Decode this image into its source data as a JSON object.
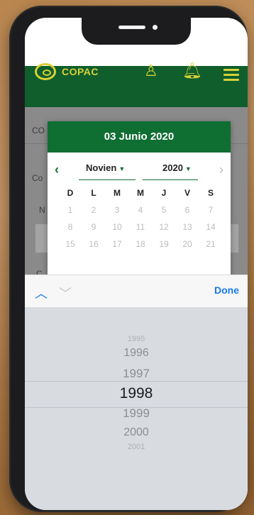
{
  "app": {
    "brand": "COPAC",
    "colors": {
      "primary": "#0f5e2c",
      "accent": "#d8d036",
      "ios_blue": "#1a7ae8"
    }
  },
  "page": {
    "label_1": "CO",
    "label_2": "Co",
    "label_3": "N",
    "label_4": "C"
  },
  "datepicker": {
    "header": "03 Junio 2020",
    "month_select": "Novien",
    "year_select": "2020",
    "weekdays": [
      "D",
      "L",
      "M",
      "M",
      "J",
      "V",
      "S"
    ],
    "week1": [
      "1",
      "2",
      "3",
      "4",
      "5",
      "6",
      "7"
    ],
    "week2": [
      "8",
      "9",
      "10",
      "11",
      "12",
      "13",
      "14"
    ],
    "week3": [
      "15",
      "16",
      "17",
      "18",
      "19",
      "20",
      "21"
    ]
  },
  "toolbar": {
    "done_label": "Done"
  },
  "picker": {
    "items": [
      "1995",
      "1996",
      "1997",
      "1998",
      "1999",
      "2000",
      "2001"
    ],
    "selected_index": 3
  }
}
